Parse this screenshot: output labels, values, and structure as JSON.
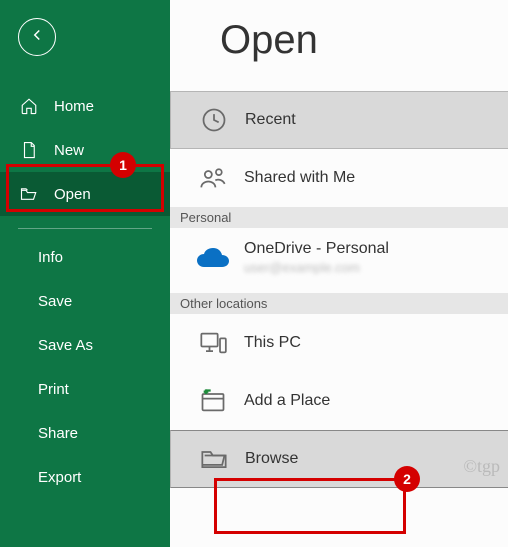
{
  "sidebar": {
    "home": "Home",
    "new": "New",
    "open": "Open",
    "info": "Info",
    "save": "Save",
    "saveAs": "Save As",
    "print": "Print",
    "share": "Share",
    "export": "Export"
  },
  "main": {
    "title": "Open",
    "recent": "Recent",
    "shared": "Shared with Me",
    "personalLabel": "Personal",
    "onedrive": {
      "title": "OneDrive - Personal",
      "sub": "user@example.com"
    },
    "otherLabel": "Other locations",
    "thisPC": "This PC",
    "addPlace": "Add a Place",
    "browse": "Browse"
  },
  "annot": {
    "one": "1",
    "two": "2"
  },
  "watermark": "©tgp"
}
